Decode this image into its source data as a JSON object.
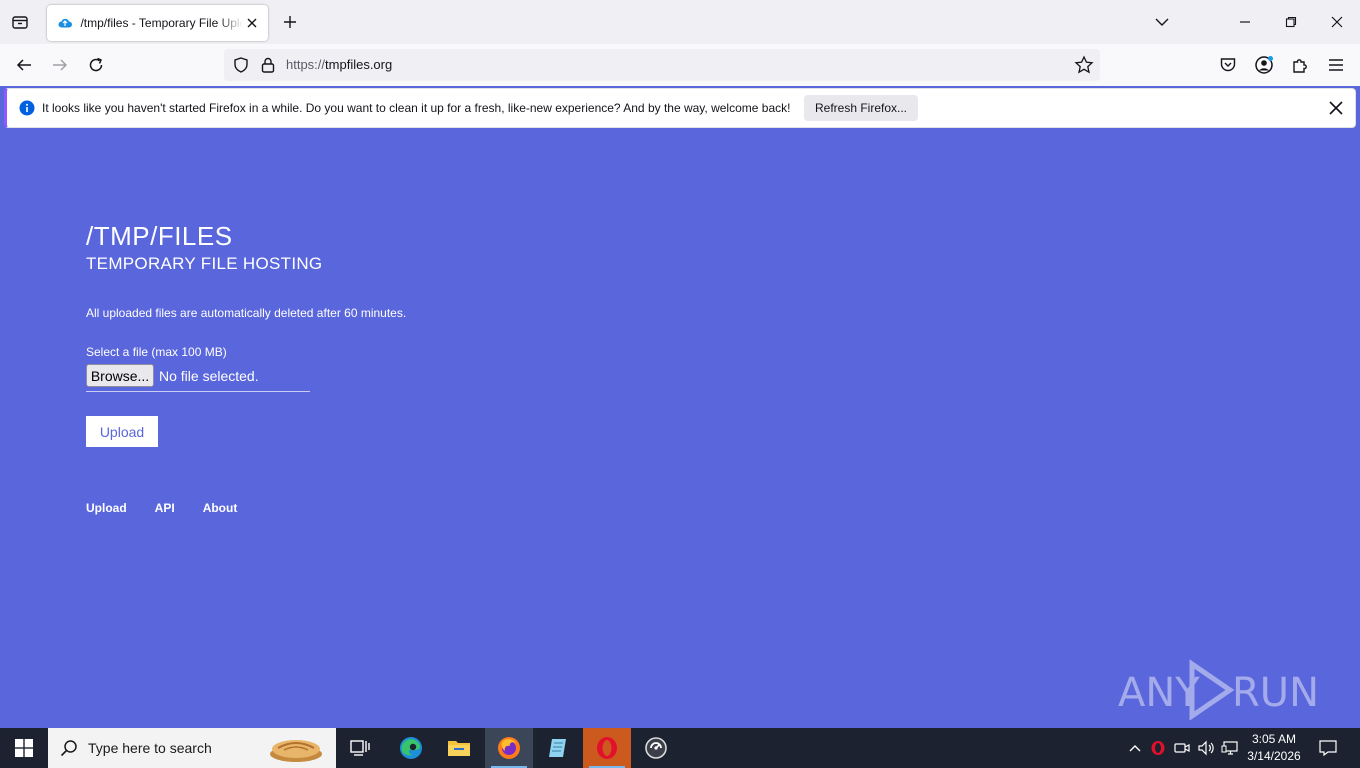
{
  "browser": {
    "tab_title": "/tmp/files - Temporary File Upload",
    "url_scheme": "https://",
    "url_host": "tmpfiles.org",
    "notification_text": "It looks like you haven't started Firefox in a while. Do you want to clean it up for a fresh, like-new experience? And by the way, welcome back!",
    "notification_button": "Refresh Firefox..."
  },
  "page": {
    "title": "/TMP/FILES",
    "subtitle": "TEMPORARY FILE HOSTING",
    "note": "All uploaded files are automatically deleted after 60 minutes.",
    "file_label": "Select a file (max 100 MB)",
    "browse_label": "Browse...",
    "file_status": "No file selected.",
    "upload_label": "Upload",
    "footer_links": [
      "Upload",
      "API",
      "About"
    ],
    "watermark": "ANY RUN"
  },
  "taskbar": {
    "search_placeholder": "Type here to search",
    "time": "3:05 AM",
    "date": "3/14/2026"
  },
  "colors": {
    "page_bg": "#5a66dc",
    "accent": "#9059ff",
    "taskbar_bg": "#1c2230"
  }
}
